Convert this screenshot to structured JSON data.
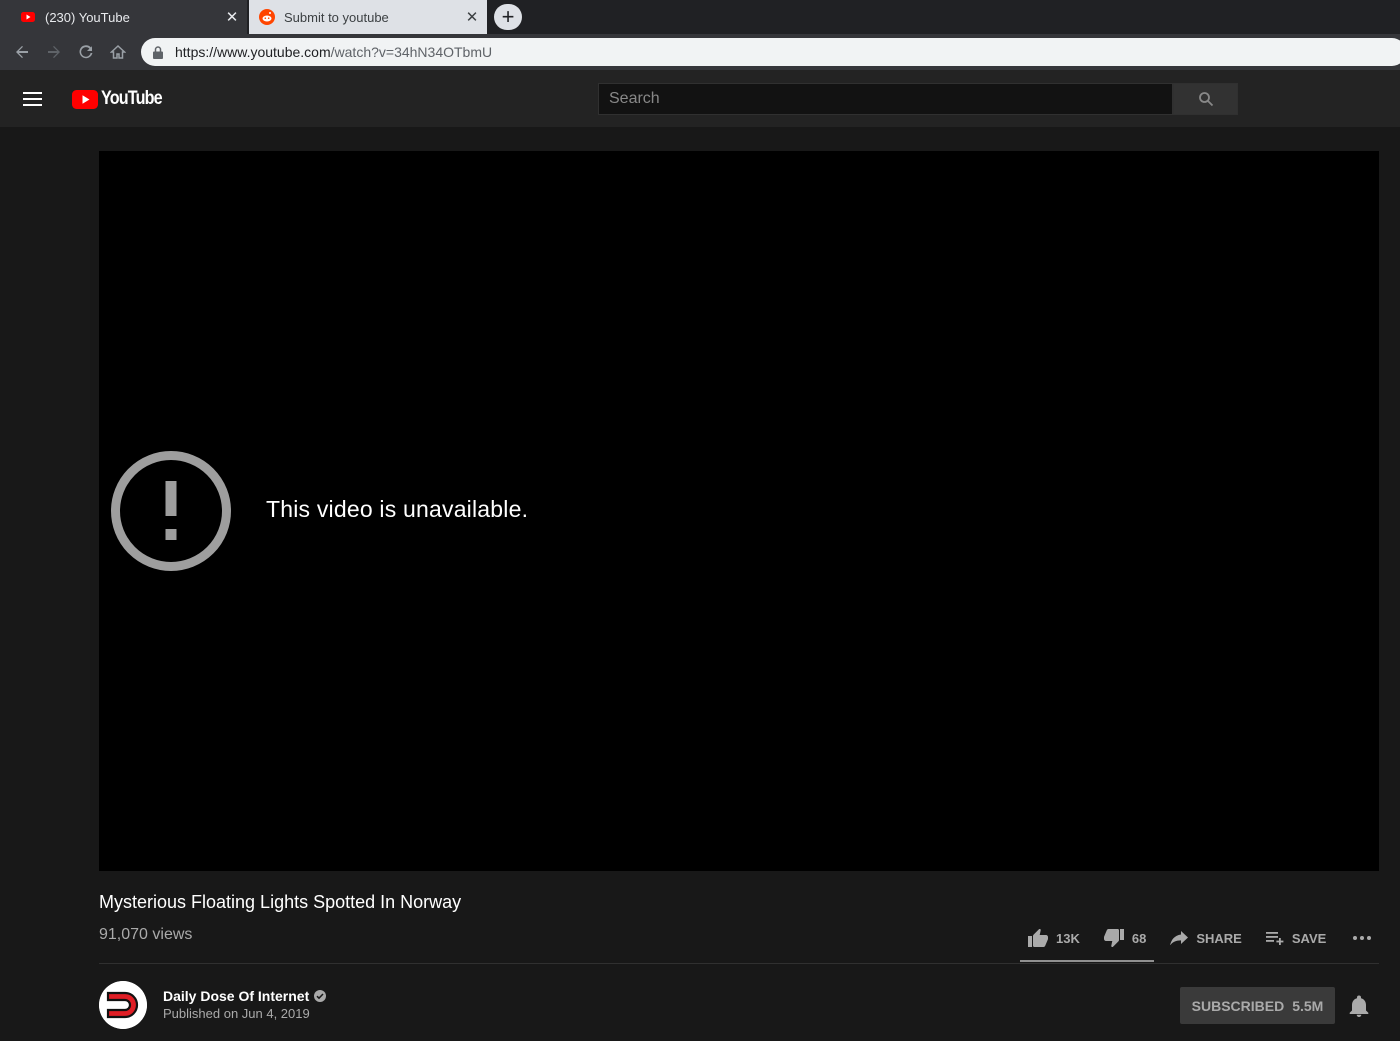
{
  "browser": {
    "tabs": [
      {
        "title": "(230) YouTube",
        "favicon": "youtube-icon",
        "active": true
      },
      {
        "title": "Submit to youtube",
        "favicon": "reddit-icon",
        "active": false
      }
    ],
    "new_tab_label": "+",
    "url_host": "https://www.youtube.com",
    "url_path": "/watch?v=34hN34OTbmU"
  },
  "masthead": {
    "logo_text": "YouTube",
    "search_placeholder": "Search"
  },
  "player": {
    "error_message": "This video is unavailable."
  },
  "video": {
    "title": "Mysterious Floating Lights Spotted In Norway",
    "views": "91,070 views",
    "likes": "13K",
    "dislikes": "68",
    "share_label": "SHARE",
    "save_label": "SAVE"
  },
  "channel": {
    "name": "Daily Dose Of Internet",
    "published": "Published on Jun 4, 2019",
    "subscribe_label": "SUBSCRIBED",
    "subscriber_count": "5.5M"
  },
  "colors": {
    "youtube_red": "#ff0000",
    "page_bg": "#181818",
    "masthead_bg": "#232323",
    "reddit_orange": "#ff4500"
  }
}
